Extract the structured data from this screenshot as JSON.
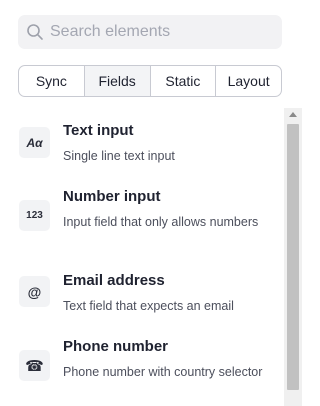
{
  "search": {
    "placeholder": "Search elements",
    "value": "",
    "icon": "search-icon"
  },
  "tabs": [
    {
      "label": "Sync",
      "active": false
    },
    {
      "label": "Fields",
      "active": true
    },
    {
      "label": "Static",
      "active": false
    },
    {
      "label": "Layout",
      "active": false
    }
  ],
  "elements": [
    {
      "badge": "Aα",
      "icon": "text-input-icon",
      "title": "Text input",
      "description": "Single line text input"
    },
    {
      "badge": "123",
      "icon": "number-input-icon",
      "title": "Number input",
      "description": "Input field that only allows numbers"
    },
    {
      "badge": "@",
      "icon": "email-icon",
      "title": "Email address",
      "description": "Text field that expects an email"
    },
    {
      "badge": "☎",
      "icon": "phone-icon",
      "title": "Phone number",
      "description": "Phone number with country selector"
    }
  ]
}
